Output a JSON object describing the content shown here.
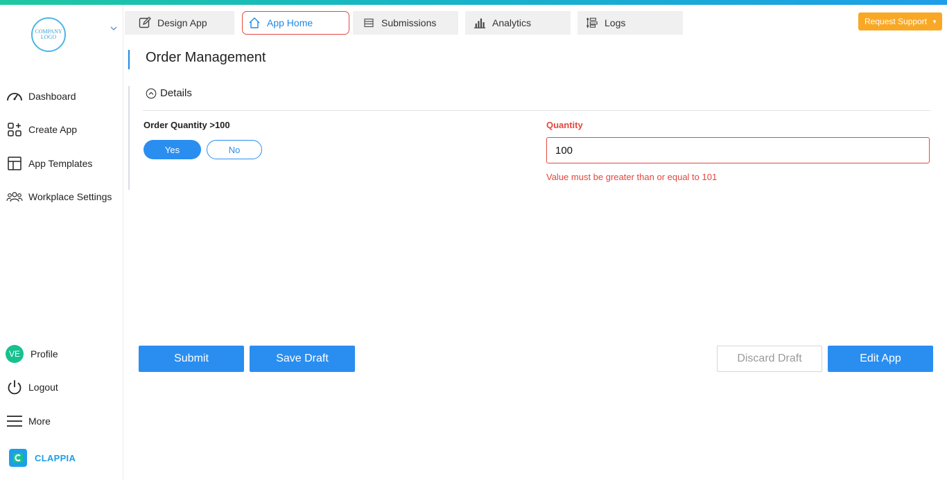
{
  "logo": {
    "text": "COMPANY LOGO"
  },
  "sidebar": {
    "items": [
      {
        "label": "Dashboard",
        "icon": "speedometer-icon"
      },
      {
        "label": "Create App",
        "icon": "grid-plus-icon"
      },
      {
        "label": "App Templates",
        "icon": "layout-template-icon"
      },
      {
        "label": "Workplace Settings",
        "icon": "users-group-icon"
      }
    ],
    "profile": {
      "initials": "VE",
      "label": "Profile"
    },
    "logout": {
      "label": "Logout"
    },
    "more": {
      "label": "More"
    },
    "brand": {
      "label": "CLAPPIA"
    }
  },
  "tabs": [
    {
      "label": "Design App",
      "icon": "edit-icon"
    },
    {
      "label": "App Home",
      "icon": "home-icon",
      "active": true
    },
    {
      "label": "Submissions",
      "icon": "list-icon"
    },
    {
      "label": "Analytics",
      "icon": "bar-chart-icon"
    },
    {
      "label": "Logs",
      "icon": "logs-icon"
    }
  ],
  "support": {
    "label": "Request Support"
  },
  "page": {
    "title": "Order Management",
    "section": "Details",
    "order_qty": {
      "label": "Order Quantity >100",
      "options": [
        "Yes",
        "No"
      ],
      "selected": "Yes"
    },
    "quantity": {
      "label": "Quantity",
      "value": "100",
      "error": "Value must be greater than or equal to 101"
    }
  },
  "actions": {
    "submit": "Submit",
    "save_draft": "Save Draft",
    "discard_draft": "Discard Draft",
    "edit_app": "Edit App"
  },
  "colors": {
    "accent": "#2a8ef0",
    "error": "#e5463d",
    "support": "#f9a825",
    "brand": "#1e9ee8"
  }
}
